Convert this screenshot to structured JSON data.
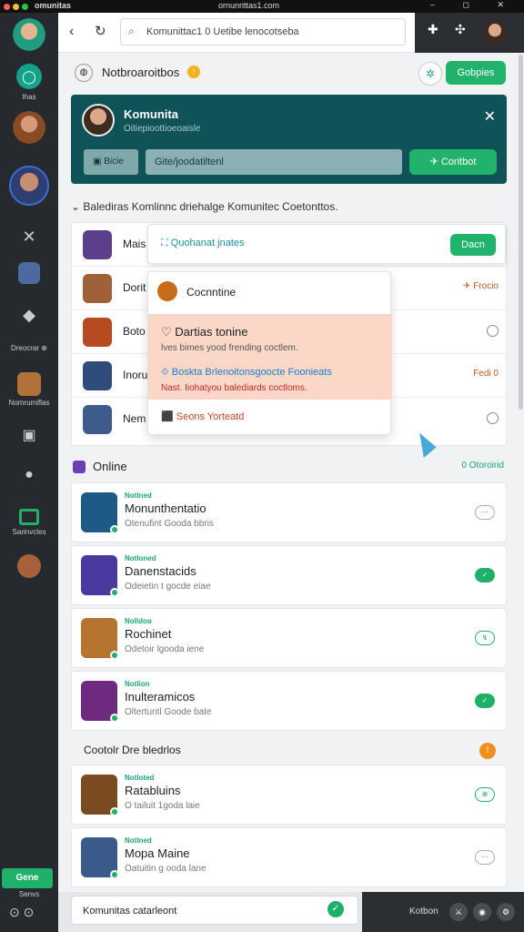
{
  "titlebar": {
    "app": "omunitas",
    "url": "ornunrittas1.com"
  },
  "rail": {
    "labels": [
      "Ihas",
      "Dreocrar ⊕",
      "Nomrumiflas",
      "Sarinvcles",
      "Gene",
      "Senvs"
    ]
  },
  "nav": {
    "search": "Komunittac1 0 Uetibe lenocotseba"
  },
  "header": {
    "title": "Notbroaroitbos",
    "button": "Gobpies"
  },
  "banner": {
    "name": "Komunita",
    "sub": "Oitiepioottioeoaisle",
    "btn": "Bicie",
    "input": "Gite/joodatiltenl",
    "go": "Coritbot"
  },
  "section_title": "Balediras Komlinnc driehalge Komunitec Coetonttos.",
  "list": [
    {
      "name": "Mais"
    },
    {
      "name": "Dorit",
      "right": "✈ Frocio"
    },
    {
      "name": "Boto"
    },
    {
      "name": "Inoru",
      "right": "Fedi 0"
    },
    {
      "name": "Nem"
    }
  ],
  "popup1": {
    "link": "Quohanat jnates",
    "btn": "Dacn"
  },
  "popup2": {
    "header": "Cocnntine",
    "a1": "Dartias tonine",
    "a2": "lves bimes yood frending coctlem.",
    "a3": "Boskta Brlenoitonsgoocte Foonieats",
    "a4": "Nast. Iiohatyou balediards coctloms.",
    "a5": "Seons Yorteatd"
  },
  "online": {
    "title": "Online",
    "right": "0 Otoroirid"
  },
  "cards": [
    {
      "tag": "Notlned",
      "name": "Monunthentatio",
      "sub": "Otenufint Gooda bbris",
      "act": "···"
    },
    {
      "tag": "Notloned",
      "name": "Danenstacids",
      "sub": "Odeietin t gocde eiae",
      "act": "✓"
    },
    {
      "tag": "Nolldoo",
      "name": "Rochinet",
      "sub": "Odetoir lgooda iene",
      "act": "↯"
    },
    {
      "tag": "Notlion",
      "name": "Inulteramicos",
      "sub": "Oltertuntl Goode bate",
      "act": "✓"
    },
    {
      "tag": "Notloted",
      "name": "Ratabluins",
      "sub": "O tailuit 1goda laie",
      "act": "⊕"
    },
    {
      "tag": "Notlned",
      "name": "Mopa Maine",
      "sub": "Oatuitin g ooda lane",
      "act": "···"
    }
  ],
  "section2": {
    "title": "Cootolr Dre bledrlos"
  },
  "bottom": {
    "input": "Komunitas catarleont",
    "right": "Kotbon"
  },
  "colors": {
    "accent": "#21b36b",
    "banner": "#0f5257",
    "rail": "#26292d"
  }
}
